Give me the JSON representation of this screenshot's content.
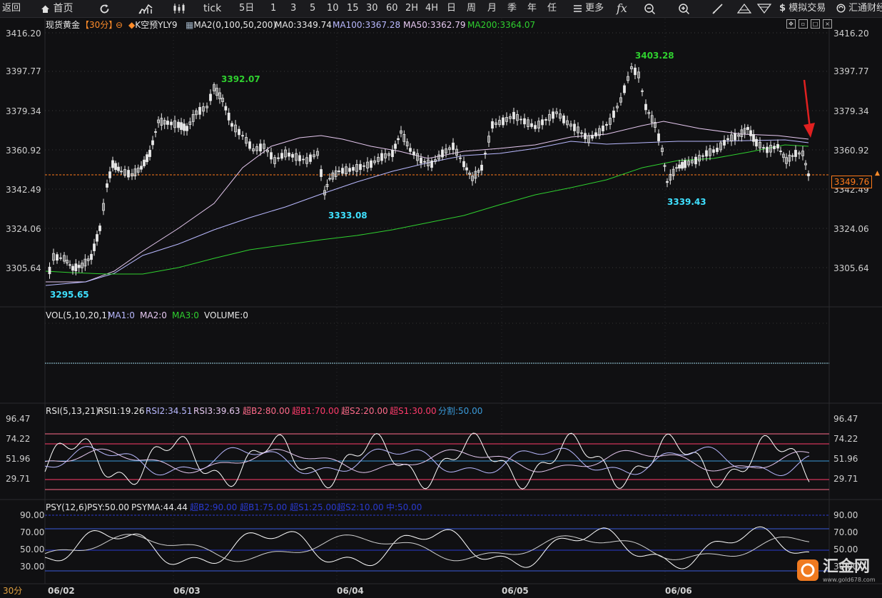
{
  "toolbar": {
    "back": "返回",
    "home": "首页",
    "tick": "tick",
    "periods": [
      "5日",
      "1",
      "3",
      "5",
      "10",
      "15",
      "30",
      "60",
      "2H",
      "4H",
      "日",
      "周",
      "月",
      "季",
      "年",
      "任"
    ],
    "more": "更多",
    "sim_trade": "模拟交易",
    "brand": "汇通财经"
  },
  "main_indicator": {
    "symbol": "现货黄金",
    "period": "【30分】",
    "k_label": "K空预YLY9",
    "ma_label": "MA2(0,100,50,200)",
    "ma0": "MA0:3349.74",
    "ma100": "MA100:3367.28",
    "ma50": "MA50:3362.79",
    "ma200": "MA200:3364.07"
  },
  "price_axis": [
    "3416.20",
    "3397.77",
    "3379.34",
    "3360.92",
    "3342.49",
    "3324.06",
    "3305.64"
  ],
  "current_price": "3349.76",
  "annotations": {
    "high1": "3392.07",
    "high2": "3403.28",
    "low1": "3295.65",
    "low2": "3333.08",
    "low3": "3339.43"
  },
  "vol": {
    "label": "VOL(5,10,20,1)",
    "ma1": "MA1:0",
    "ma2": "MA2:0",
    "ma3": "MA3:0",
    "volume": "VOLUME:0"
  },
  "rsi": {
    "label": "RSI(5,13,21)",
    "rsi1": "RSI1:19.26",
    "rsi2": "RSI2:34.51",
    "rsi3": "RSI3:39.63",
    "b2": "超B2:80.00",
    "b1": "超B1:70.00",
    "s2": "超S2:20.00",
    "s1": "超S1:30.00",
    "div": "分割:50.00",
    "axis": [
      "96.47",
      "74.22",
      "51.96",
      "29.71"
    ]
  },
  "psy": {
    "label": "PSY(12,6)",
    "psy": "PSY:50.00",
    "psyma": "PSYMA:44.44",
    "b2": "超B2:90.00",
    "b1": "超B1:75.00",
    "s1": "超S1:25.00",
    "s2": "超S2:10.00",
    "mid": "中:50.00",
    "axis": [
      "90.00",
      "70.00",
      "50.00",
      "30.00"
    ]
  },
  "dates": [
    "06/02",
    "06/03",
    "06/04",
    "06/05",
    "06/06"
  ],
  "period_badge": "30分",
  "watermark": {
    "brand": "汇金网",
    "url": "www.gold678.com"
  },
  "colors": {
    "up": "#ffffff",
    "down": "#ffffff",
    "ma50": "#e6c8f0",
    "ma100": "#b9b9ff",
    "ma200": "#2fd02f",
    "annotation_low": "#3fe0ff",
    "annotation_high": "#2fd02f",
    "price_line": "#ff7a1a",
    "arrow": "#e02020"
  }
}
